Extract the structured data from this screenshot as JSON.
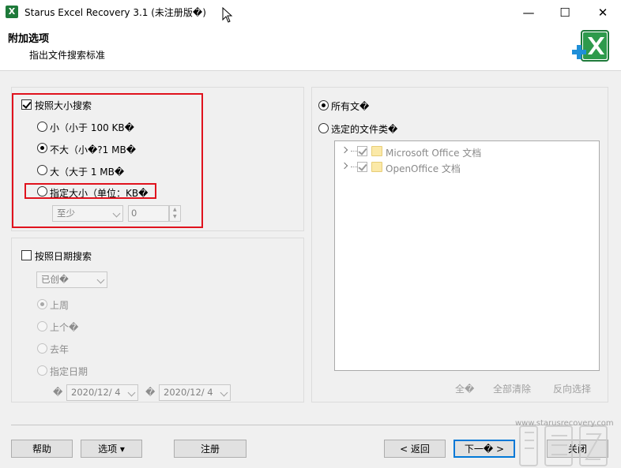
{
  "window": {
    "title": "Starus Excel Recovery 3.1 (未注册版�)",
    "minimize": "—",
    "maximize": "☐",
    "close": "✕",
    "app_icon_letter": "X"
  },
  "header": {
    "title": "附加选项",
    "subtitle": "指出文件搜索标准"
  },
  "size_search": {
    "label": "按照大小搜索",
    "checked": true,
    "options": [
      {
        "label": "小（小于 100 KB�",
        "selected": false
      },
      {
        "label": "不大（小�?1 MB�",
        "selected": true
      },
      {
        "label": "大（大于 1 MB�",
        "selected": false
      },
      {
        "label": "指定大小（单位：KB�",
        "selected": false
      }
    ],
    "min_combo_value": "至少",
    "min_spin_value": "0"
  },
  "date_search": {
    "label": "按照日期搜索",
    "checked": false,
    "mode_combo_value": "已创�",
    "options": [
      {
        "label": "上周",
        "selected": true
      },
      {
        "label": "上个�",
        "selected": false
      },
      {
        "label": "去年",
        "selected": false
      },
      {
        "label": "指定日期",
        "selected": false
      }
    ],
    "date_prefix": "�",
    "date_from": "2020/12/  4",
    "date_to_prefix": "�",
    "date_to": "2020/12/  4"
  },
  "file_types": {
    "all_files_label": "所有文�",
    "selected_types_label": "选定的文件类�",
    "tree_items": [
      {
        "label": "Microsoft Office 文档",
        "checked": true
      },
      {
        "label": "OpenOffice 文档",
        "checked": true
      }
    ],
    "select_all": "全�",
    "clear_all": "全部清除",
    "invert": "反向选择"
  },
  "buttons": {
    "help": "帮助",
    "options": "选项 ▾",
    "register": "注册",
    "back": "< 返回",
    "next": "下一� >",
    "close": "关闭"
  },
  "watermark": {
    "site": "www.starusrecovery.com"
  },
  "colors": {
    "highlight_red": "#e0121d",
    "excel_green": "#1e7a3a",
    "plus_blue": "#1f8fd8"
  }
}
